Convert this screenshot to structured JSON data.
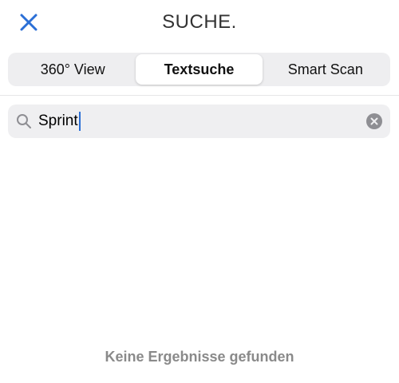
{
  "header": {
    "title": "SUCHE.",
    "close_icon": "close-icon",
    "accent_color": "#2b6fd6"
  },
  "tabs": [
    {
      "label": "360° View",
      "active": false
    },
    {
      "label": "Textsuche",
      "active": true
    },
    {
      "label": "Smart Scan",
      "active": false
    }
  ],
  "search": {
    "value": "Sprint",
    "icon": "search-icon",
    "clear_icon": "clear-icon"
  },
  "results": {
    "empty_message": "Keine Ergebnisse gefunden"
  }
}
